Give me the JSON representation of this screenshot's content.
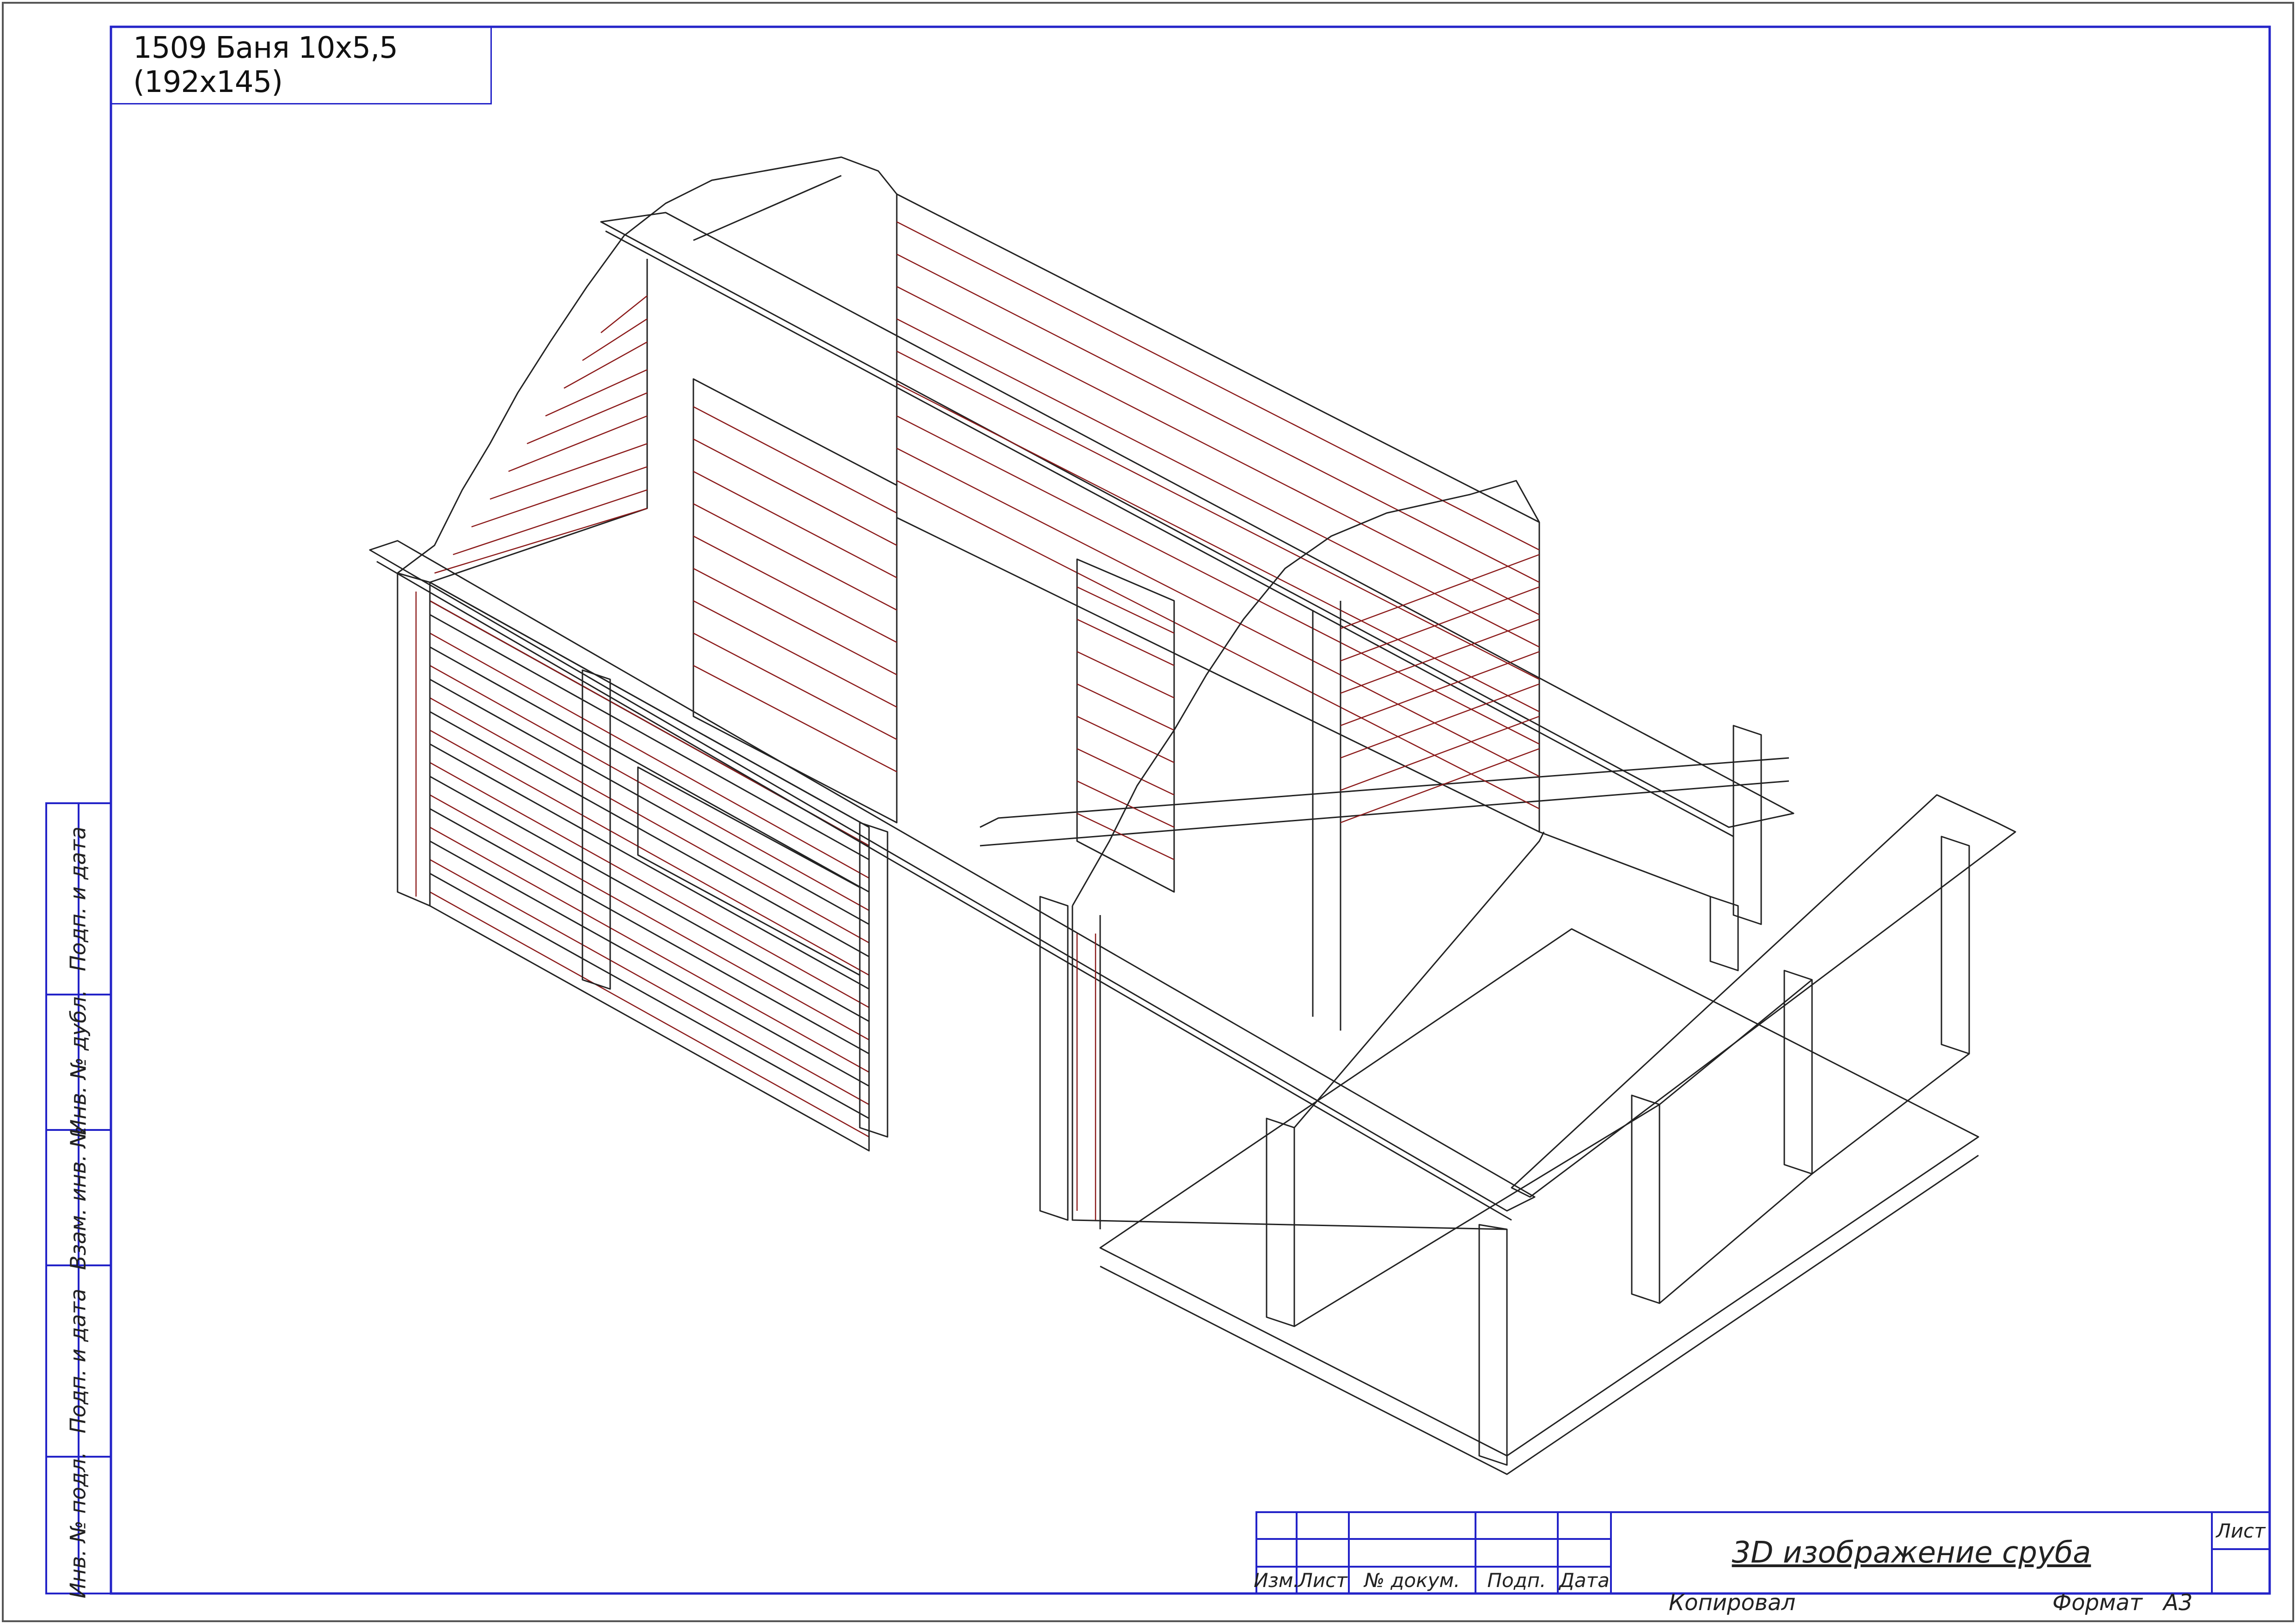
{
  "drawing": {
    "title": "1509 Баня 10х5,5 (192х145)",
    "sheet_title": "3D изображение сруба"
  },
  "side_stamp": {
    "labels": [
      "Подп. и дата",
      "Инв. № дубл.",
      "Взам. инв. №",
      "Подп. и дата",
      "Инв. № подл."
    ]
  },
  "title_block": {
    "columns": [
      "Изм.",
      "Лист",
      "№ докум.",
      "Подп.",
      "Дата"
    ],
    "sheet_label": "Лист",
    "copied_label": "Копировал",
    "format_label": "Формат",
    "format_value": "А3"
  },
  "colors": {
    "frame": "#2323c8",
    "line": "#222222",
    "log_accent": "#8b1a1a"
  }
}
